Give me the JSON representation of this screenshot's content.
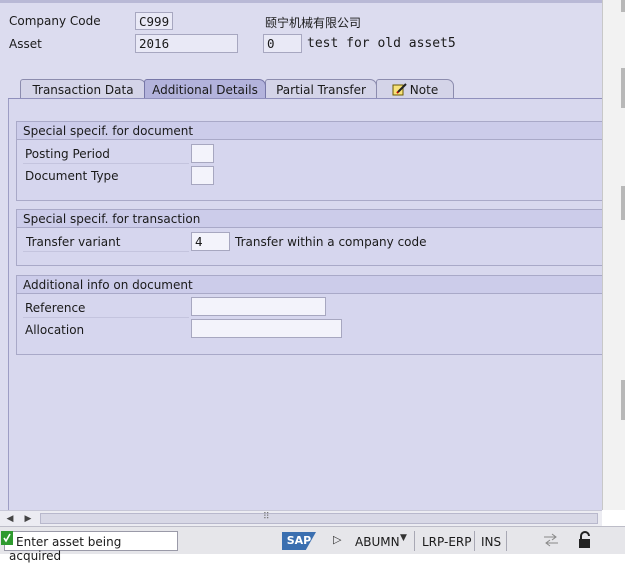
{
  "header": {
    "company_code_label": "Company Code",
    "company_code_value": "C999",
    "company_name": "颐宁机械有限公司",
    "asset_label": "Asset",
    "asset_value": "2016",
    "asset_subnumber": "0",
    "asset_description": "test for old asset5"
  },
  "tabs": [
    {
      "label": "Transaction Data"
    },
    {
      "label": "Additional Details",
      "active": true
    },
    {
      "label": "Partial Transfer"
    },
    {
      "label": "Note",
      "icon": "note-icon"
    }
  ],
  "groups": {
    "document": {
      "title": "Special specif. for document",
      "posting_period_label": "Posting Period",
      "posting_period_value": "",
      "document_type_label": "Document Type",
      "document_type_value": ""
    },
    "transaction": {
      "title": "Special specif. for transaction",
      "transfer_variant_label": "Transfer variant",
      "transfer_variant_value": "4",
      "transfer_variant_text": "Transfer within a company code"
    },
    "additional": {
      "title": "Additional info on document",
      "reference_label": "Reference",
      "reference_value": "",
      "allocation_label": "Allocation",
      "allocation_value": ""
    }
  },
  "hscroll": {
    "grip": "⠿"
  },
  "statusbar": {
    "message": "Enter asset being acquired",
    "message_icon": "success-check-icon",
    "logo": "SAP",
    "transaction": "ABUMN",
    "system": "LRP-ERP",
    "mode": "INS"
  },
  "colors": {
    "panel": "#d8d8ee",
    "active_tab": "#b3b3dc",
    "status_ok": "#2e9a2e"
  }
}
